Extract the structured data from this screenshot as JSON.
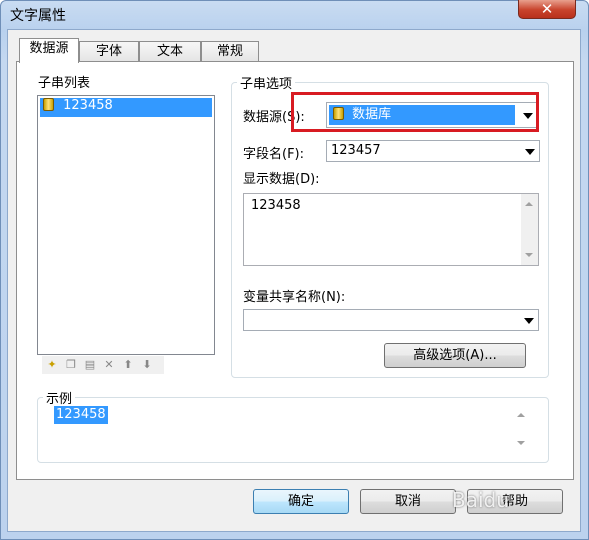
{
  "window": {
    "title": "文字属性",
    "close_label": "✕"
  },
  "tabs": [
    {
      "label": "数据源",
      "active": true
    },
    {
      "label": "字体",
      "active": false
    },
    {
      "label": "文本",
      "active": false
    },
    {
      "label": "常规",
      "active": false
    }
  ],
  "substring_list": {
    "title": "子串列表",
    "items": [
      "123458"
    ],
    "toolbar": [
      "new-icon",
      "copy-icon",
      "paste-icon",
      "delete-icon",
      "move-up-icon",
      "move-down-icon"
    ]
  },
  "substring_options": {
    "title": "子串选项",
    "data_source_label": "数据源(S):",
    "data_source_value": "数据库",
    "field_name_label": "字段名(F):",
    "field_name_value": "123457",
    "display_data_label": "显示数据(D):",
    "display_data_value": "123458",
    "shared_var_label": "变量共享名称(N):",
    "shared_var_value": "",
    "advanced_button": "高级选项(A)..."
  },
  "example": {
    "title": "示例",
    "value": "123458"
  },
  "buttons": {
    "ok": "确定",
    "cancel": "取消",
    "help": "帮助"
  },
  "watermark": "Baidu",
  "colors": {
    "selection": "#3399ff",
    "highlight_box": "#d81b22"
  }
}
